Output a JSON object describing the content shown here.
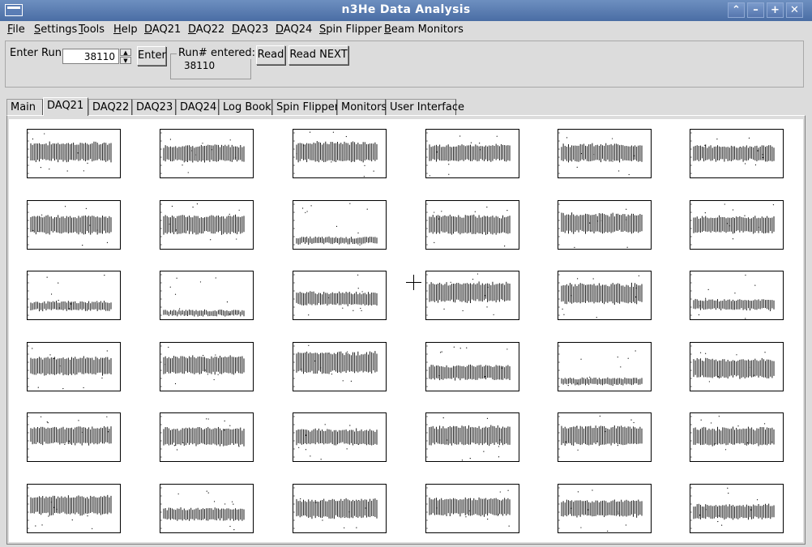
{
  "window": {
    "title": "n3He Data Analysis"
  },
  "menu": [
    {
      "label": "File",
      "key": "F",
      "rest": "ile"
    },
    {
      "label": "Settings",
      "key": "S",
      "rest": "ettings"
    },
    {
      "label": "Tools",
      "key": "T",
      "rest": "ools"
    },
    {
      "label": "Help",
      "key": "H",
      "rest": "elp"
    },
    {
      "label": "DAQ21",
      "key": "D",
      "rest": "AQ21"
    },
    {
      "label": "DAQ22",
      "key": "D",
      "rest": "AQ22"
    },
    {
      "label": "DAQ23",
      "key": "D",
      "rest": "AQ23"
    },
    {
      "label": "DAQ24",
      "key": "D",
      "rest": "AQ24"
    },
    {
      "label": "Spin Flipper",
      "key": "S",
      "rest": "pin Flipper"
    },
    {
      "label": "Beam Monitors",
      "key": "B",
      "rest": "eam Monitors"
    }
  ],
  "run": {
    "enter_label": "Enter Run:",
    "value": "38110",
    "enter_button": "Enter",
    "entered_label": "Run# entered:",
    "entered_value": "38110",
    "read_button": "Read",
    "read_next_button": "Read NEXT"
  },
  "tabs": [
    "Main",
    "DAQ21",
    "DAQ22",
    "DAQ23",
    "DAQ24",
    "Log Book",
    "Spin Flipper",
    "Monitors",
    "User Interface"
  ],
  "active_tab": "DAQ21",
  "grid": {
    "cols": 6,
    "rows": 6,
    "n_bins": 48,
    "outliers": 9
  },
  "plots": [
    {
      "base": 0.55,
      "spread": 0.34
    },
    {
      "base": 0.52,
      "spread": 0.3
    },
    {
      "base": 0.55,
      "spread": 0.36
    },
    {
      "base": 0.53,
      "spread": 0.3
    },
    {
      "base": 0.53,
      "spread": 0.32
    },
    {
      "base": 0.52,
      "spread": 0.28
    },
    {
      "base": 0.52,
      "spread": 0.33
    },
    {
      "base": 0.52,
      "spread": 0.33
    },
    {
      "base": 0.2,
      "spread": 0.12
    },
    {
      "base": 0.52,
      "spread": 0.34
    },
    {
      "base": 0.55,
      "spread": 0.36
    },
    {
      "base": 0.52,
      "spread": 0.3
    },
    {
      "base": 0.3,
      "spread": 0.16
    },
    {
      "base": 0.16,
      "spread": 0.1
    },
    {
      "base": 0.45,
      "spread": 0.24
    },
    {
      "base": 0.58,
      "spread": 0.36
    },
    {
      "base": 0.55,
      "spread": 0.36
    },
    {
      "base": 0.33,
      "spread": 0.18
    },
    {
      "base": 0.53,
      "spread": 0.32
    },
    {
      "base": 0.55,
      "spread": 0.32
    },
    {
      "base": 0.6,
      "spread": 0.38
    },
    {
      "base": 0.4,
      "spread": 0.26
    },
    {
      "base": 0.22,
      "spread": 0.12
    },
    {
      "base": 0.48,
      "spread": 0.34
    },
    {
      "base": 0.55,
      "spread": 0.32
    },
    {
      "base": 0.53,
      "spread": 0.32
    },
    {
      "base": 0.52,
      "spread": 0.28
    },
    {
      "base": 0.55,
      "spread": 0.34
    },
    {
      "base": 0.55,
      "spread": 0.34
    },
    {
      "base": 0.53,
      "spread": 0.32
    },
    {
      "base": 0.58,
      "spread": 0.34
    },
    {
      "base": 0.4,
      "spread": 0.22
    },
    {
      "base": 0.52,
      "spread": 0.34
    },
    {
      "base": 0.55,
      "spread": 0.32
    },
    {
      "base": 0.52,
      "spread": 0.3
    },
    {
      "base": 0.45,
      "spread": 0.26
    }
  ]
}
